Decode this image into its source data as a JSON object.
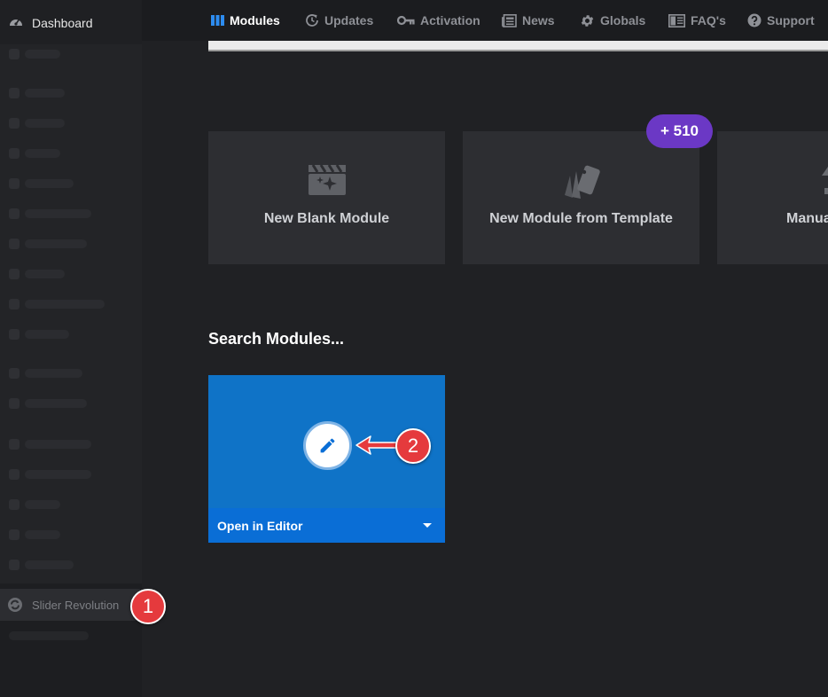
{
  "sidebar": {
    "dashboard_label": "Dashboard",
    "slider_revolution_label": "Slider Revolution",
    "callout_1": "1"
  },
  "topnav": {
    "items": [
      {
        "label": "Modules",
        "icon": "columns-icon",
        "active": true
      },
      {
        "label": "Updates",
        "icon": "refresh-clock-icon"
      },
      {
        "label": "Activation",
        "icon": "key-icon"
      },
      {
        "label": "News",
        "icon": "newspaper-icon"
      },
      {
        "label": "Globals",
        "icon": "gear-icon"
      },
      {
        "label": "FAQ's",
        "icon": "book-icon"
      },
      {
        "label": "Support",
        "icon": "question-circle-icon"
      }
    ]
  },
  "cards": {
    "blank": {
      "label": "New Blank Module",
      "icon": "clapperboard-sparkle-icon"
    },
    "template": {
      "label": "New Module from Template",
      "icon": "cards-stack-icon"
    },
    "manual": {
      "label": "Manua",
      "icon": "upload-icon"
    },
    "template_badge": "+ 510"
  },
  "search": {
    "title": "Search Modules..."
  },
  "module": {
    "footer_label": "Open in Editor",
    "edit_icon": "pencil-icon",
    "callout_2": "2"
  },
  "colors": {
    "accent_blue": "#0f73c7",
    "badge_purple": "#6b38c5",
    "callout_red": "#e53a3d"
  }
}
